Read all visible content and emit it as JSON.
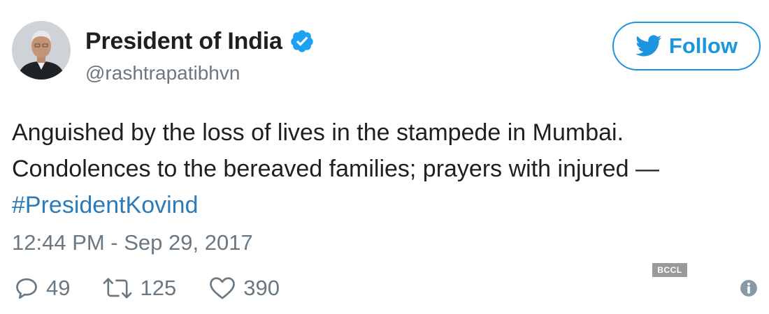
{
  "author": {
    "display_name": "President of India",
    "handle": "@rashtrapatibhvn",
    "verified": true,
    "avatar_icon": "profile-photo"
  },
  "follow_button": {
    "label": "Follow",
    "icon": "twitter-bird-icon",
    "color": "#1b95e0"
  },
  "tweet": {
    "line1": "Anguished by the loss of lives in the stampede in Mumbai.",
    "line2": "Condolences to the bereaved families; prayers with injured —",
    "hashtag": "#PresidentKovind",
    "hashtag_color": "#2b7bb9",
    "timestamp": "12:44 PM - Sep 29, 2017"
  },
  "watermark": "BCCL",
  "actions": {
    "replies": "49",
    "retweets": "125",
    "likes": "390"
  },
  "colors": {
    "text": "#1c2022",
    "secondary": "#697882",
    "accent": "#1b95e0"
  }
}
